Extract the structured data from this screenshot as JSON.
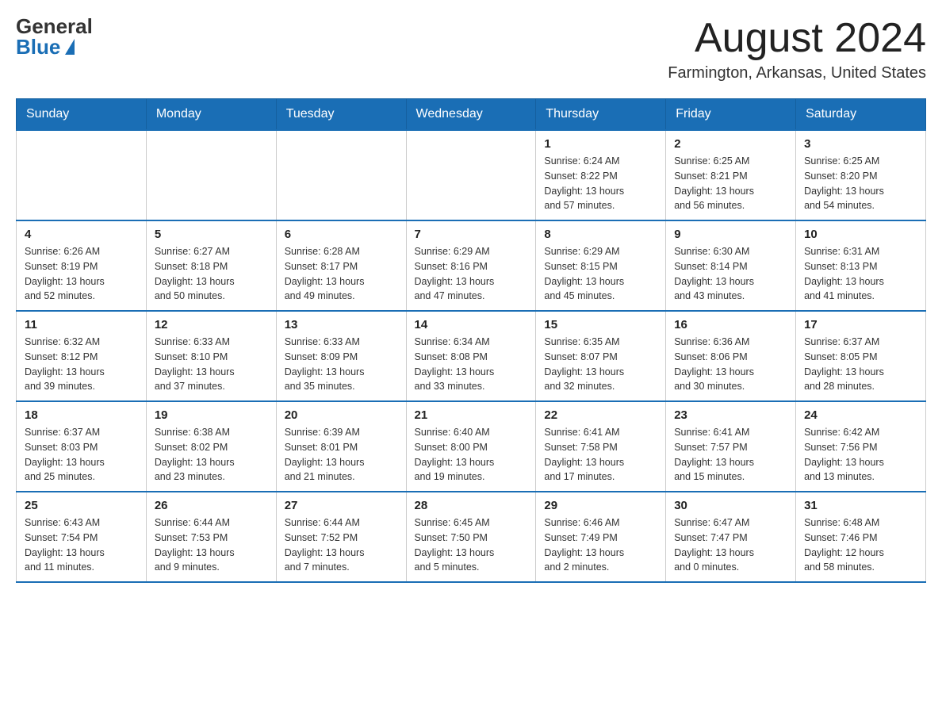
{
  "header": {
    "logo_general": "General",
    "logo_blue": "Blue",
    "month_title": "August 2024",
    "location": "Farmington, Arkansas, United States"
  },
  "days_of_week": [
    "Sunday",
    "Monday",
    "Tuesday",
    "Wednesday",
    "Thursday",
    "Friday",
    "Saturday"
  ],
  "weeks": [
    [
      {
        "day": "",
        "info": ""
      },
      {
        "day": "",
        "info": ""
      },
      {
        "day": "",
        "info": ""
      },
      {
        "day": "",
        "info": ""
      },
      {
        "day": "1",
        "info": "Sunrise: 6:24 AM\nSunset: 8:22 PM\nDaylight: 13 hours\nand 57 minutes."
      },
      {
        "day": "2",
        "info": "Sunrise: 6:25 AM\nSunset: 8:21 PM\nDaylight: 13 hours\nand 56 minutes."
      },
      {
        "day": "3",
        "info": "Sunrise: 6:25 AM\nSunset: 8:20 PM\nDaylight: 13 hours\nand 54 minutes."
      }
    ],
    [
      {
        "day": "4",
        "info": "Sunrise: 6:26 AM\nSunset: 8:19 PM\nDaylight: 13 hours\nand 52 minutes."
      },
      {
        "day": "5",
        "info": "Sunrise: 6:27 AM\nSunset: 8:18 PM\nDaylight: 13 hours\nand 50 minutes."
      },
      {
        "day": "6",
        "info": "Sunrise: 6:28 AM\nSunset: 8:17 PM\nDaylight: 13 hours\nand 49 minutes."
      },
      {
        "day": "7",
        "info": "Sunrise: 6:29 AM\nSunset: 8:16 PM\nDaylight: 13 hours\nand 47 minutes."
      },
      {
        "day": "8",
        "info": "Sunrise: 6:29 AM\nSunset: 8:15 PM\nDaylight: 13 hours\nand 45 minutes."
      },
      {
        "day": "9",
        "info": "Sunrise: 6:30 AM\nSunset: 8:14 PM\nDaylight: 13 hours\nand 43 minutes."
      },
      {
        "day": "10",
        "info": "Sunrise: 6:31 AM\nSunset: 8:13 PM\nDaylight: 13 hours\nand 41 minutes."
      }
    ],
    [
      {
        "day": "11",
        "info": "Sunrise: 6:32 AM\nSunset: 8:12 PM\nDaylight: 13 hours\nand 39 minutes."
      },
      {
        "day": "12",
        "info": "Sunrise: 6:33 AM\nSunset: 8:10 PM\nDaylight: 13 hours\nand 37 minutes."
      },
      {
        "day": "13",
        "info": "Sunrise: 6:33 AM\nSunset: 8:09 PM\nDaylight: 13 hours\nand 35 minutes."
      },
      {
        "day": "14",
        "info": "Sunrise: 6:34 AM\nSunset: 8:08 PM\nDaylight: 13 hours\nand 33 minutes."
      },
      {
        "day": "15",
        "info": "Sunrise: 6:35 AM\nSunset: 8:07 PM\nDaylight: 13 hours\nand 32 minutes."
      },
      {
        "day": "16",
        "info": "Sunrise: 6:36 AM\nSunset: 8:06 PM\nDaylight: 13 hours\nand 30 minutes."
      },
      {
        "day": "17",
        "info": "Sunrise: 6:37 AM\nSunset: 8:05 PM\nDaylight: 13 hours\nand 28 minutes."
      }
    ],
    [
      {
        "day": "18",
        "info": "Sunrise: 6:37 AM\nSunset: 8:03 PM\nDaylight: 13 hours\nand 25 minutes."
      },
      {
        "day": "19",
        "info": "Sunrise: 6:38 AM\nSunset: 8:02 PM\nDaylight: 13 hours\nand 23 minutes."
      },
      {
        "day": "20",
        "info": "Sunrise: 6:39 AM\nSunset: 8:01 PM\nDaylight: 13 hours\nand 21 minutes."
      },
      {
        "day": "21",
        "info": "Sunrise: 6:40 AM\nSunset: 8:00 PM\nDaylight: 13 hours\nand 19 minutes."
      },
      {
        "day": "22",
        "info": "Sunrise: 6:41 AM\nSunset: 7:58 PM\nDaylight: 13 hours\nand 17 minutes."
      },
      {
        "day": "23",
        "info": "Sunrise: 6:41 AM\nSunset: 7:57 PM\nDaylight: 13 hours\nand 15 minutes."
      },
      {
        "day": "24",
        "info": "Sunrise: 6:42 AM\nSunset: 7:56 PM\nDaylight: 13 hours\nand 13 minutes."
      }
    ],
    [
      {
        "day": "25",
        "info": "Sunrise: 6:43 AM\nSunset: 7:54 PM\nDaylight: 13 hours\nand 11 minutes."
      },
      {
        "day": "26",
        "info": "Sunrise: 6:44 AM\nSunset: 7:53 PM\nDaylight: 13 hours\nand 9 minutes."
      },
      {
        "day": "27",
        "info": "Sunrise: 6:44 AM\nSunset: 7:52 PM\nDaylight: 13 hours\nand 7 minutes."
      },
      {
        "day": "28",
        "info": "Sunrise: 6:45 AM\nSunset: 7:50 PM\nDaylight: 13 hours\nand 5 minutes."
      },
      {
        "day": "29",
        "info": "Sunrise: 6:46 AM\nSunset: 7:49 PM\nDaylight: 13 hours\nand 2 minutes."
      },
      {
        "day": "30",
        "info": "Sunrise: 6:47 AM\nSunset: 7:47 PM\nDaylight: 13 hours\nand 0 minutes."
      },
      {
        "day": "31",
        "info": "Sunrise: 6:48 AM\nSunset: 7:46 PM\nDaylight: 12 hours\nand 58 minutes."
      }
    ]
  ]
}
